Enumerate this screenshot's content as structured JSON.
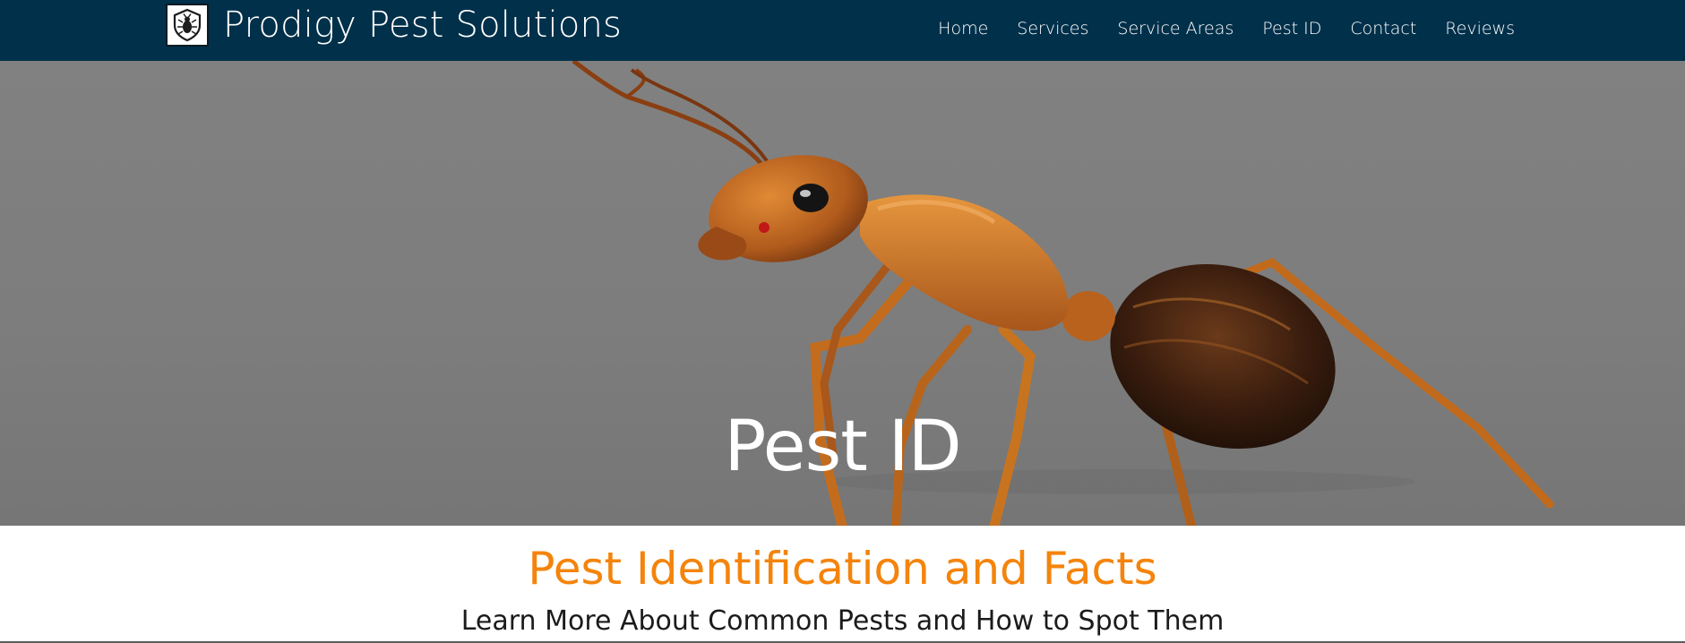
{
  "brand": {
    "name": "Prodigy Pest Solutions",
    "logo_icon": "shield-bug-icon"
  },
  "nav": {
    "items": [
      {
        "label": "Home"
      },
      {
        "label": "Services"
      },
      {
        "label": "Service Areas"
      },
      {
        "label": "Pest ID"
      },
      {
        "label": "Contact"
      },
      {
        "label": "Reviews"
      }
    ]
  },
  "hero": {
    "title": "Pest ID",
    "image": "ant-photo"
  },
  "section": {
    "title": "Pest Identification and Facts",
    "subtitle": "Learn More About Common Pests and How to Spot Them"
  },
  "colors": {
    "navbar": "#01304a",
    "accent_orange": "#f4840c",
    "hero_gray": "#7d7d7d"
  }
}
